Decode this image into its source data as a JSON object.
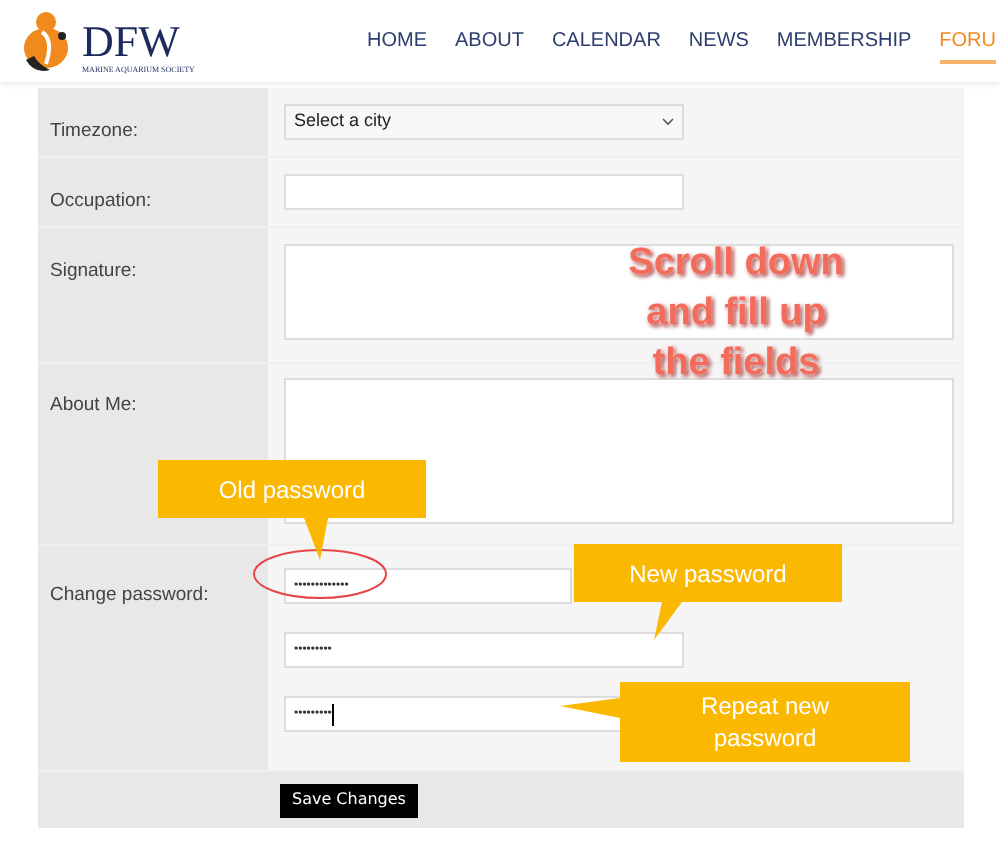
{
  "logo": {
    "title": "DFW",
    "subtitle": "MARINE AQUARIUM SOCIETY"
  },
  "nav": [
    {
      "label": "HOME",
      "selected": false
    },
    {
      "label": "ABOUT",
      "selected": false
    },
    {
      "label": "CALENDAR",
      "selected": false
    },
    {
      "label": "NEWS",
      "selected": false
    },
    {
      "label": "MEMBERSHIP",
      "selected": false
    },
    {
      "label": "FORU",
      "selected": true
    }
  ],
  "form": {
    "rows": [
      {
        "label": "Timezone:",
        "kind": "select",
        "fields": [
          {
            "value": "Select a city"
          }
        ]
      },
      {
        "label": "Occupation:",
        "kind": "input"
      },
      {
        "label": "Signature:",
        "kind": "textarea"
      },
      {
        "label": "About Me:",
        "kind": "textarea-tall"
      },
      {
        "label": "Change password:",
        "kind": "password",
        "fields": [
          {
            "value": "•••••••••••••"
          },
          {
            "value": "•••••••••"
          },
          {
            "value": "•••••••••",
            "focused": true
          }
        ]
      }
    ],
    "submit": "Save Changes"
  },
  "annotations": {
    "note": [
      "Scroll down",
      "and fill up",
      "the fields"
    ],
    "callouts": [
      {
        "text": "Old password",
        "kind": "old"
      },
      {
        "text": "New password",
        "kind": "new"
      },
      {
        "text": "Repeat new password",
        "kind": "repeat"
      }
    ]
  }
}
